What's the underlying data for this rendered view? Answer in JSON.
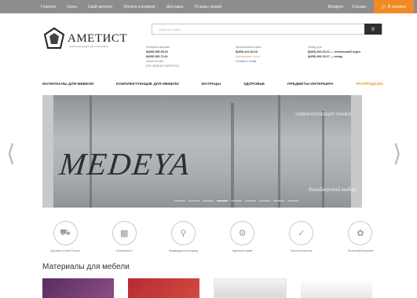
{
  "topbar": {
    "links": [
      "Главная",
      "Цены",
      "Свой артикул",
      "Оплата и возврат",
      "Доставка",
      "Отзывы людей"
    ],
    "account": "Вход/рег",
    "phone": "Отзывы",
    "cart_label": "В корзине",
    "cart_icon": "cart-icon"
  },
  "header": {
    "logo_text": "АМЕТИСТ",
    "logo_tagline": "мебельная фурнитура и материалы",
    "search_placeholder": "Поиск по сайту",
    "search_icon": "search-icon",
    "contacts": [
      {
        "title": "Интернет-магазин",
        "lines": [
          "8(499) 555-55-64",
          "8(499) 350-73-61"
        ],
        "extra": "Заказ на сайт",
        "note": "(ПО СВОЕМУ ЗАПРОСУ)"
      },
      {
        "title": "Центральный офис",
        "lines": [
          "8(499) 441-54-18"
        ],
        "extra": "Консультант: пн-пт",
        "note": "Оставить отзыв"
      },
      {
        "title": "Склад для",
        "lines": [
          "8(499) 406-03-12 — технический отдел",
          "8(499) 406-03-17 — склад"
        ],
        "extra": "",
        "note": ""
      }
    ]
  },
  "nav": {
    "items": [
      "МАТЕРИАЛЫ ДЛЯ МЕБЕЛИ",
      "КОМПЛЕКТУЮЩИЕ ДЛЯ МЕБЕЛИ",
      "МАТРАЦЫ",
      "ЗДОРОВЬЕ",
      "ПРЕДМЕТЫ ИНТЕРЬЕРА",
      "РАСПРОДАЖА"
    ]
  },
  "banner": {
    "brand": "MEDEYA",
    "collection": "НОВАЯ КОЛЛЕКЦИЯ ТКАНЕЙ",
    "subtitle": "дизайнерский выбор",
    "slide_count": 9,
    "active_slide": 3
  },
  "features": [
    {
      "icon": "truck-icon",
      "label": "Доставка по всей России"
    },
    {
      "icon": "chart-icon",
      "label": "Стабильность"
    },
    {
      "icon": "award-icon",
      "label": "Индивидуальный подход"
    },
    {
      "icon": "gear-icon",
      "label": "Надежный сервис"
    },
    {
      "icon": "check-icon",
      "label": "Гарантия качества"
    },
    {
      "icon": "flower-icon",
      "label": "Эксклюзивный дизайн"
    }
  ],
  "section": {
    "title": "Материалы для мебели"
  },
  "colors": {
    "accent": "#f08a24",
    "topbar": "#8d8d8d"
  }
}
